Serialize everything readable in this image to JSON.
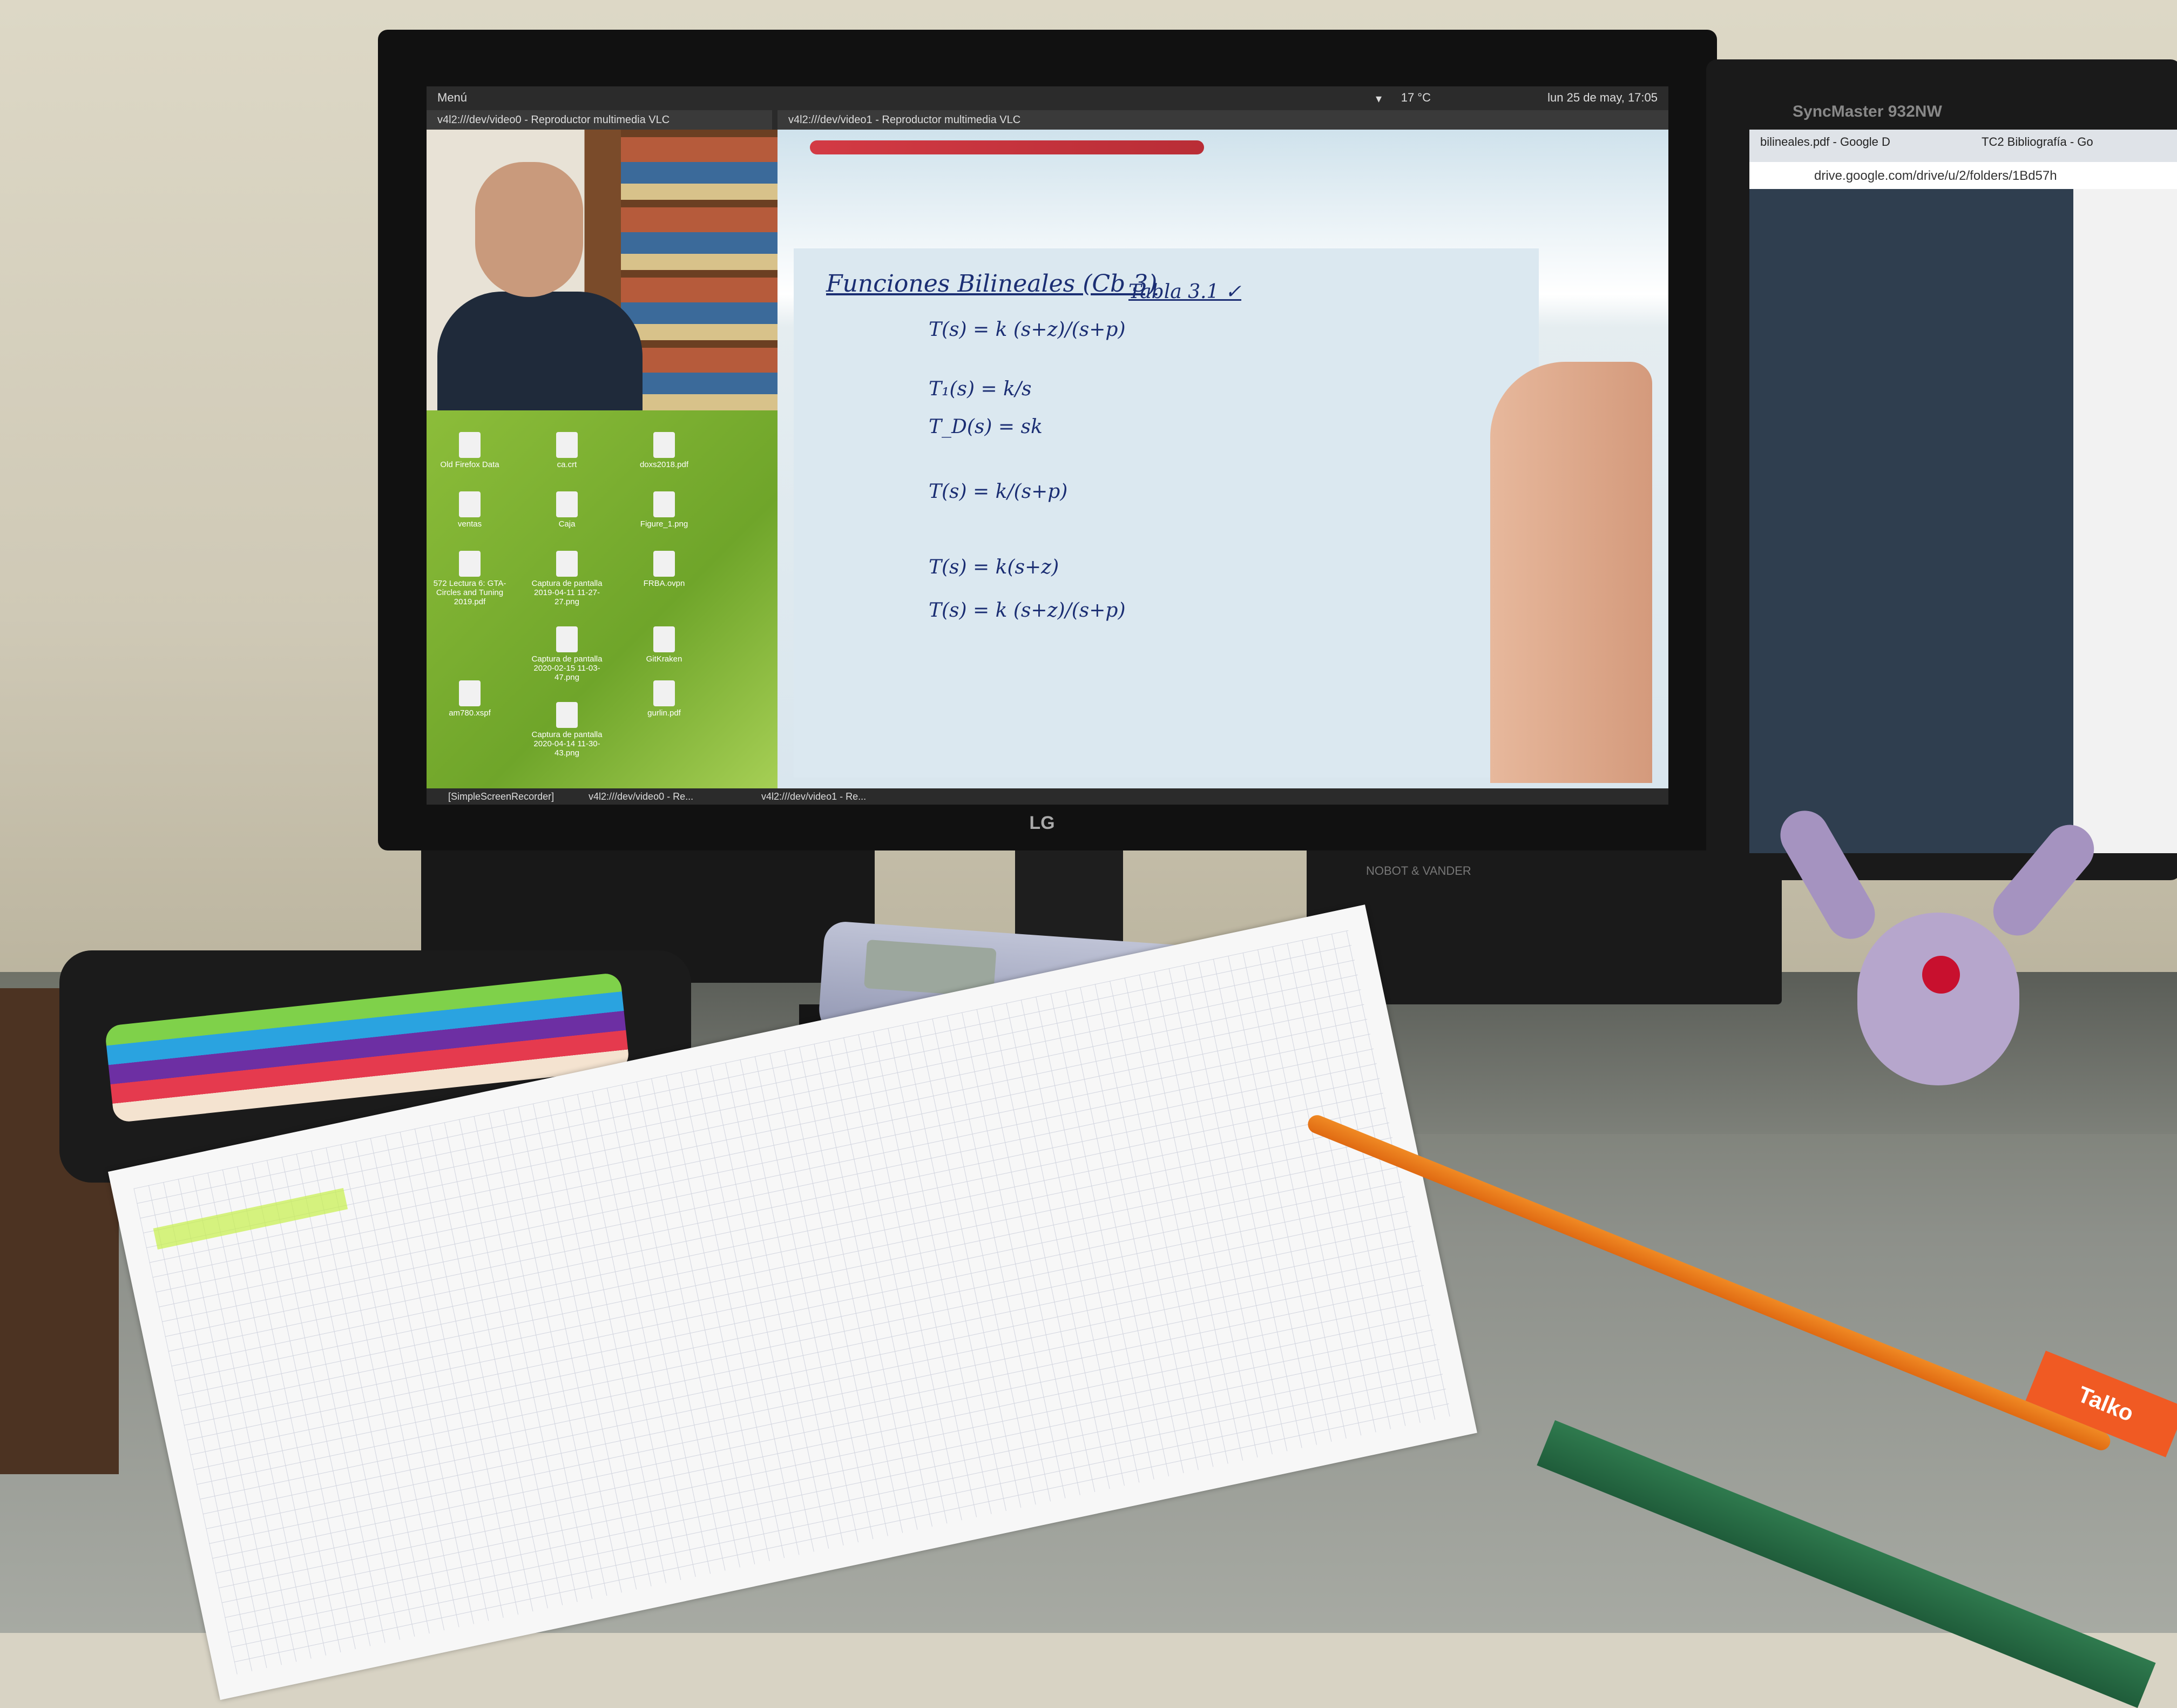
{
  "scene": {
    "type": "photo of a desk with monitors showing an online lecture"
  },
  "monitor_main": {
    "brand": "LG",
    "topbar": {
      "menu": "Menú",
      "clock": "lun 25 de may, 17:05",
      "temperature": "17 °C"
    },
    "windows": {
      "vlc_webcam_title": "v4l2:///dev/video0 - Reproductor multimedia VLC",
      "vlc_board_title": "v4l2:///dev/video1 - Reproductor multimedia VLC"
    },
    "desktop_icons": [
      {
        "label": "Old Firefox Data"
      },
      {
        "label": "ca.crt"
      },
      {
        "label": "doxs2018.pdf"
      },
      {
        "label": "ventas"
      },
      {
        "label": "Caja"
      },
      {
        "label": "Figure_1.png"
      },
      {
        "label": "572 Lectura 6: GTA-Circles and Tuning 2019.pdf"
      },
      {
        "label": "Captura de pantalla 2019-04-11 11-27-27.png"
      },
      {
        "label": "FRBA.ovpn"
      },
      {
        "label": "Captura de pantalla 2020-02-15 11-03-47.png"
      },
      {
        "label": "GitKraken"
      },
      {
        "label": "am780.xspf"
      },
      {
        "label": "Captura de pantalla 2020-04-14 11-30-43.png"
      },
      {
        "label": "gurlin.pdf"
      }
    ],
    "whiteboard": {
      "title": "Funciones Bilineales (Cb 3)",
      "table_ref": "Tabla 3.1 ✓",
      "equations": [
        "T(s) = k (s+z)/(s+p)",
        "T₁(s) = k/s",
        "T_D(s) = sk",
        "T(s) = k/(s+p)",
        "T(s) = k(s+z)",
        "T(s) = k (s+z)/(s+p)"
      ]
    },
    "taskbar": [
      "[SimpleScreenRecorder]",
      "v4l2:///dev/video0 - Re...",
      "v4l2:///dev/video1 - Re..."
    ]
  },
  "monitor_secondary": {
    "brand": "SyncMaster 932NW",
    "tabs": [
      "bilineales.pdf - Google D",
      "TC2 Bibliografía - Go"
    ],
    "url": "drive.google.com/drive/u/2/folders/1Bd57h"
  },
  "desk_objects": {
    "eraser_label": "Talko",
    "speaker_label": "NOBOT & VANDER"
  },
  "colors": {
    "desktop_wallpaper": "#7ab334",
    "whiteboard_ink": "#1b2e73",
    "highlighter": "#c6f04a",
    "plush": "#b6a6cc",
    "plush_gem": "#c8102e"
  }
}
